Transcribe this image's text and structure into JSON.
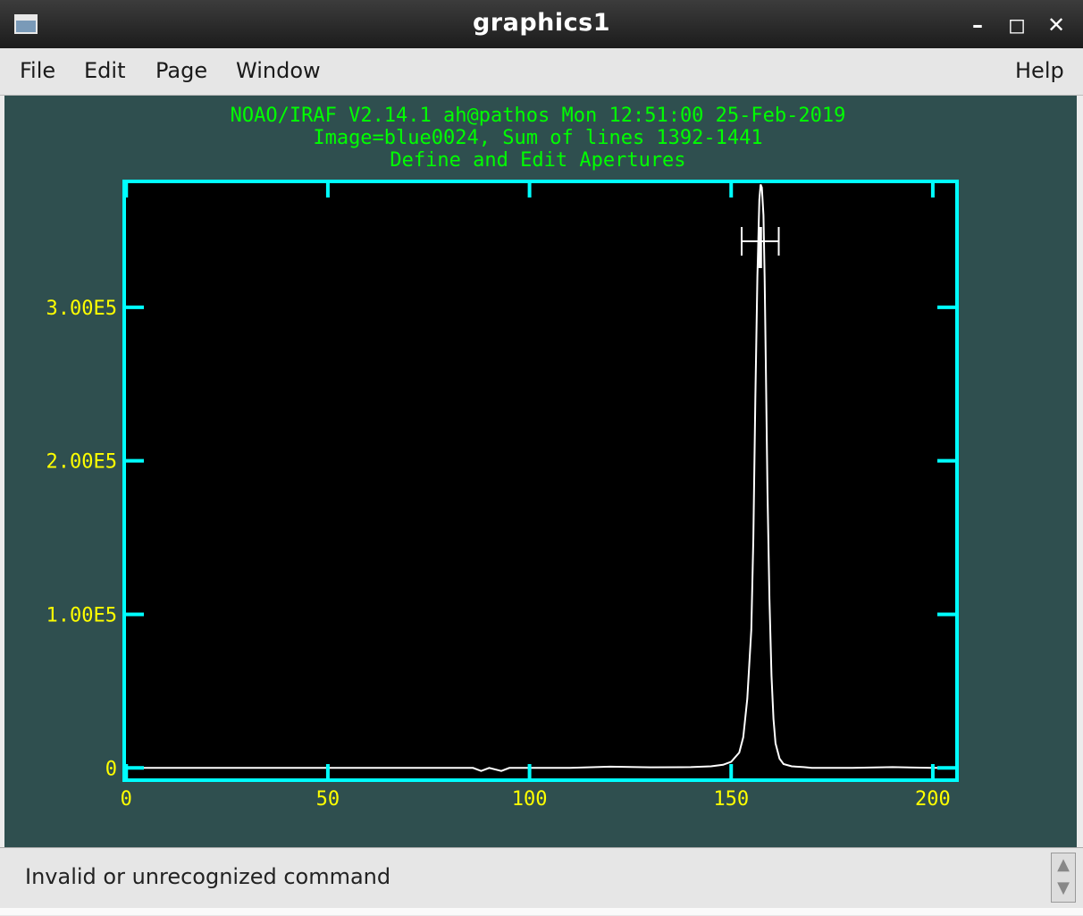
{
  "window": {
    "title": "graphics1"
  },
  "menubar": {
    "file": "File",
    "edit": "Edit",
    "page": "Page",
    "window": "Window",
    "help": "Help"
  },
  "plot": {
    "header_lines": [
      "NOAO/IRAF V2.14.1 ah@pathos Mon 12:51:00 25-Feb-2019",
      "Image=blue0024, Sum of lines 1392-1441",
      "Define and Edit Apertures"
    ],
    "colors": {
      "background": "#2f4f4f",
      "frame": "#00ffff",
      "labels": "#ffff00",
      "header": "#00ff00",
      "trace": "#ffffff"
    }
  },
  "chart_data": {
    "type": "line",
    "title": "Define and Edit Apertures",
    "x_ticks": [
      "0",
      "50",
      "100",
      "150",
      "200"
    ],
    "y_ticks": [
      "0",
      "1.00E5",
      "2.00E5",
      "3.00E5"
    ],
    "xlim": [
      -0.5,
      206
    ],
    "ylim": [
      -8000,
      382000
    ],
    "grid": false,
    "x": [
      0,
      86,
      88,
      90,
      93,
      95,
      100,
      110,
      120,
      130,
      140,
      145,
      148,
      150,
      152,
      153,
      154,
      155,
      155.5,
      156,
      156.5,
      157,
      157.3,
      157.6,
      158,
      158.3,
      158.6,
      159,
      159.5,
      160,
      160.5,
      161,
      162,
      163,
      165,
      168,
      170,
      180,
      190,
      200,
      206
    ],
    "y": [
      0,
      0,
      -2000,
      0,
      -2000,
      0,
      0,
      0,
      800,
      400,
      500,
      1000,
      2000,
      4000,
      10000,
      20000,
      45000,
      90000,
      150000,
      240000,
      320000,
      370000,
      380000,
      378000,
      360000,
      320000,
      260000,
      180000,
      110000,
      60000,
      32000,
      16000,
      6000,
      2500,
      1000,
      500,
      0,
      0,
      500,
      0,
      0
    ],
    "aperture": {
      "center": 157.2,
      "lower": 152.6,
      "upper": 161.8,
      "level": 343000
    }
  },
  "status": {
    "message": "Invalid or unrecognized command"
  },
  "scrollbar": {
    "up": "▲",
    "down": "▼"
  }
}
